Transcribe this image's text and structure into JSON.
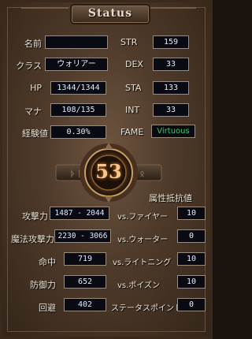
{
  "window": {
    "title": "Status"
  },
  "stats_top": [
    {
      "label": "名前",
      "value": ""
    },
    {
      "label": "クラス",
      "value": "ウォリアー"
    },
    {
      "label": "HP",
      "value": "1344/1344"
    },
    {
      "label": "マナ",
      "value": "108/135"
    },
    {
      "label": "経験値",
      "value": "0.30%"
    }
  ],
  "attributes": [
    {
      "label": "STR",
      "value": "159"
    },
    {
      "label": "DEX",
      "value": "33"
    },
    {
      "label": "STA",
      "value": "133"
    },
    {
      "label": "INT",
      "value": "33"
    }
  ],
  "fame": {
    "label": "FAME",
    "value": "Virtuous",
    "color": "#3cc86a"
  },
  "level": {
    "value": "53"
  },
  "resist_header": "属性抵抗値",
  "combat": [
    {
      "label": "攻撃力",
      "value": "1487 - 2044"
    },
    {
      "label": "魔法攻撃力",
      "value": "2230 - 3066"
    },
    {
      "label": "命中",
      "value": "719"
    },
    {
      "label": "防御力",
      "value": "652"
    },
    {
      "label": "回避",
      "value": "402"
    }
  ],
  "resists": [
    {
      "label": "vs.ファイヤー",
      "value": "10"
    },
    {
      "label": "vs.ウォーター",
      "value": "0"
    },
    {
      "label": "vs.ライトニング",
      "value": "10"
    },
    {
      "label": "vs.ポイズン",
      "value": "10"
    }
  ],
  "status_points": {
    "label": "ステータスポイント",
    "value": "0"
  },
  "colors": {
    "value_text": "#dfe9ff",
    "label_text": "#e6e1d6",
    "level_ring": "#c8a060"
  }
}
